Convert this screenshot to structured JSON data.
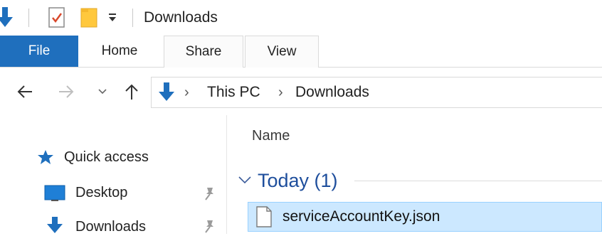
{
  "window": {
    "title": "Downloads"
  },
  "ribbon": {
    "tabs": [
      {
        "label": "File",
        "active": true
      },
      {
        "label": "Home"
      },
      {
        "label": "Share"
      },
      {
        "label": "View"
      }
    ]
  },
  "nav": {
    "back_icon": "back-arrow-icon",
    "forward_icon": "forward-arrow-icon",
    "recent_icon": "chevron-down-icon",
    "up_icon": "up-arrow-icon"
  },
  "address": {
    "breadcrumb": [
      "This PC",
      "Downloads"
    ],
    "separator": "›"
  },
  "navpane": {
    "quick_access": "Quick access",
    "items": [
      {
        "label": "Desktop",
        "icon": "desktop-icon",
        "pinned": true
      },
      {
        "label": "Downloads",
        "icon": "downloads-icon",
        "pinned": true
      }
    ]
  },
  "content": {
    "column_header": "Name",
    "groups": [
      {
        "label": "Today (1)",
        "files": [
          {
            "name": "serviceAccountKey.json",
            "selected": true
          }
        ]
      }
    ]
  },
  "colors": {
    "accent": "#1f6fbd",
    "group_header": "#1e4e9c",
    "selection": "#cce8ff",
    "folder": "#ffc83d"
  }
}
